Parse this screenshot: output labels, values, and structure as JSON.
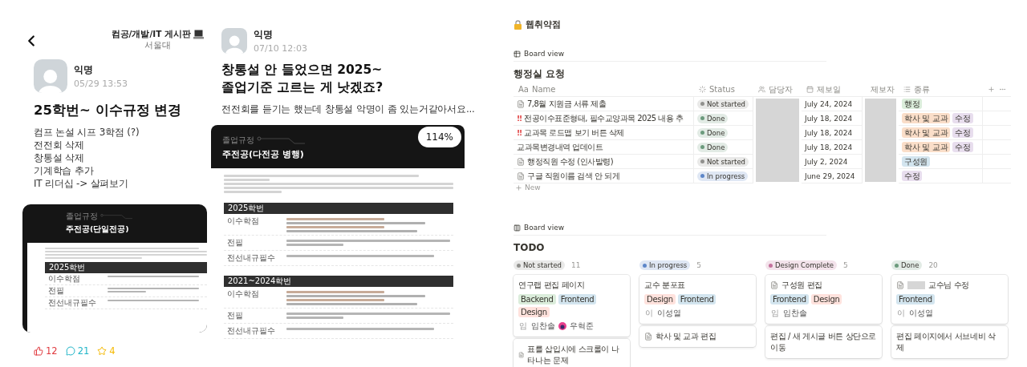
{
  "posts": [
    {
      "board": "컴공/개발/IT 게시판",
      "school": "서울대",
      "author": "익명",
      "time": "05/29 13:53",
      "title": [
        "25학번~ 이수규정 변경"
      ],
      "body": [
        "컴프 논설 시프 3학점 (?)",
        "전전회 삭제",
        "창통설 삭제",
        "기계학습 추가",
        "IT 리더십 -> 살펴보기"
      ],
      "image": {
        "label": "졸업규정",
        "heading": "주전공(단일전공)",
        "sections": [
          {
            "heading": "2025학번",
            "rows": [
              "이수학점",
              "전필",
              "전선내규필수"
            ]
          }
        ]
      },
      "reactions": [
        {
          "kind": "like",
          "count": "12"
        },
        {
          "kind": "comment",
          "count": "21"
        },
        {
          "kind": "scrap",
          "count": "4"
        }
      ]
    },
    {
      "author": "익명",
      "time": "07/10 12:03",
      "title": [
        "창통설 안 들었으면 2025~",
        "졸업기준 고르는 게 낫겠죠?"
      ],
      "body": [
        "전전회를 듣기는 했는데 창통설 악명이 좀 있는거같아서요..."
      ],
      "image": {
        "label": "졸업규정",
        "heading": "주전공(다전공 병행)",
        "zoom": "114%",
        "sections": [
          {
            "heading": "2025학번",
            "rows": [
              "이수학점",
              "전필",
              "전선내규필수"
            ]
          },
          {
            "heading": "2021~2024학번",
            "rows": [
              "이수학점",
              "전필",
              "전선내규필수"
            ]
          }
        ]
      }
    }
  ],
  "workspace": {
    "title": "웹취약점",
    "table_view": {
      "view": "Board view",
      "title": "행정실 요청",
      "new": "New",
      "columns": [
        {
          "kind": "title",
          "prefix": "Aa",
          "label": "Name"
        },
        {
          "kind": "status",
          "label": "Status"
        },
        {
          "kind": "person",
          "label": "담당자",
          "redacted": true
        },
        {
          "kind": "date",
          "label": "제보일"
        },
        {
          "kind": "text",
          "label": "제보자",
          "redacted": true
        },
        {
          "kind": "multi",
          "label": "종류"
        }
      ],
      "rows": [
        {
          "kind": "page",
          "name": "7,8월 지원금 서류 제출",
          "status": {
            "label": "Not started",
            "color": "#91918e"
          },
          "date": "July 24, 2024",
          "tags": [
            {
              "label": "행정",
              "color": "#dbeddb"
            }
          ]
        },
        {
          "kind": "urgent",
          "flag": "!!",
          "name": "전공이수표준형태, 필수교양과목 2025 내용 추",
          "status": {
            "label": "Done",
            "color": "#6c9b7d"
          },
          "date": "July 18, 2024",
          "tags": [
            {
              "label": "학사 및 교과",
              "color": "#fadec9"
            },
            {
              "label": "수정",
              "color": "#e8deee"
            }
          ]
        },
        {
          "kind": "urgent",
          "flag": "!!",
          "name": "교과목 로드맵 보기 버튼 삭제",
          "status": {
            "label": "Done",
            "color": "#6c9b7d"
          },
          "date": "July 18, 2024",
          "tags": [
            {
              "label": "학사 및 교과",
              "color": "#fadec9"
            },
            {
              "label": "수정",
              "color": "#e8deee"
            }
          ]
        },
        {
          "kind": "plain",
          "name": "교과목변경내역 업데이트",
          "status": {
            "label": "Done",
            "color": "#6c9b7d"
          },
          "date": "July 18, 2024",
          "tags": [
            {
              "label": "학사 및 교과",
              "color": "#fadec9"
            },
            {
              "label": "수정",
              "color": "#e8deee"
            }
          ]
        },
        {
          "kind": "page",
          "name": "행정직원 수정 (인사발령)",
          "status": {
            "label": "Not started",
            "color": "#91918e"
          },
          "date": "July 2, 2024",
          "tags": [
            {
              "label": "구성원",
              "color": "#d3e5ef"
            }
          ]
        },
        {
          "kind": "page",
          "name": "구글 직원이름 검색 안 되게",
          "status": {
            "label": "In progress",
            "color": "#5e87c9"
          },
          "date": "June 29, 2024",
          "tags": [
            {
              "label": "수정",
              "color": "#e8deee"
            }
          ]
        }
      ]
    },
    "board_view": {
      "view": "Board view",
      "title": "TODO",
      "groups": [
        {
          "label": "Not started",
          "color": "#91918e",
          "count": "11",
          "cards": [
            {
              "kind": "plain",
              "redacted": false,
              "title": "연구랩 편집 페이지",
              "tags": [
                {
                  "label": "Backend",
                  "color": "#dbeddb"
                },
                {
                  "label": "Frontend",
                  "color": "#d3e5ef"
                },
                {
                  "label": "Design",
                  "color": "#ffe2dd"
                }
              ],
              "people": [
                {
                  "kind": "initial",
                  "initial": "임",
                  "name": "임찬솔"
                },
                {
                  "kind": "photo",
                  "name": "우혁준"
                }
              ]
            },
            {
              "kind": "page",
              "redacted": false,
              "title": "표를 삽입시에 스크롤이 나타나는 문제"
            }
          ]
        },
        {
          "label": "In progress",
          "color": "#5e87c9",
          "count": "5",
          "cards": [
            {
              "kind": "plain",
              "redacted": false,
              "title": "교수 분포표",
              "tags": [
                {
                  "label": "Design",
                  "color": "#ffe2dd"
                },
                {
                  "label": "Frontend",
                  "color": "#d3e5ef"
                }
              ],
              "people": [
                {
                  "kind": "initial",
                  "initial": "이",
                  "name": "이성열"
                }
              ]
            },
            {
              "kind": "page",
              "redacted": false,
              "title": "학사 및 교과 편집"
            }
          ]
        },
        {
          "label": "Design Complete",
          "color": "#c4729d",
          "count": "5",
          "cards": [
            {
              "kind": "page",
              "redacted": false,
              "title": "구성원 편집",
              "tags": [
                {
                  "label": "Frontend",
                  "color": "#d3e5ef"
                },
                {
                  "label": "Design",
                  "color": "#ffe2dd"
                }
              ],
              "people": [
                {
                  "kind": "initial",
                  "initial": "임",
                  "name": "임찬솔"
                }
              ]
            },
            {
              "kind": "plain",
              "redacted": false,
              "title": "편집 / 새 게시글 버튼 상단으로 이동"
            }
          ]
        },
        {
          "label": "Done",
          "color": "#6c9b7d",
          "count": "20",
          "cards": [
            {
              "kind": "page",
              "redacted": true,
              "title": "교수님 수정",
              "tags": [
                {
                  "label": "Frontend",
                  "color": "#d3e5ef"
                }
              ],
              "people": [
                {
                  "kind": "initial",
                  "initial": "이",
                  "name": "이성열"
                }
              ]
            },
            {
              "kind": "plain",
              "redacted": false,
              "title": "편집 페이지에서 서브네비 삭제"
            }
          ]
        }
      ]
    }
  }
}
